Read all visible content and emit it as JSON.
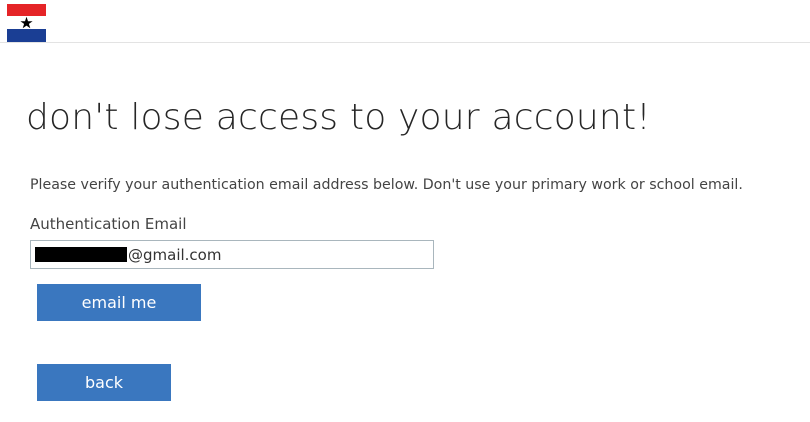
{
  "header": {
    "logo_icon": "flag-logo-icon",
    "logo_colors": {
      "red": "#e52427",
      "blue": "#1a3e94",
      "white": "#ffffff",
      "star": "#000000"
    }
  },
  "main": {
    "title": "don't lose access to your account!",
    "instructions": "Please verify your authentication email address below. Don't use your primary work or school email.",
    "email_label": "Authentication Email",
    "email_value_visible": "@gmail.com",
    "email_me_button": "email me",
    "back_button": "back"
  },
  "colors": {
    "button_bg": "#3a77bf",
    "button_text": "#ffffff",
    "input_border": "#a9b6bd"
  }
}
